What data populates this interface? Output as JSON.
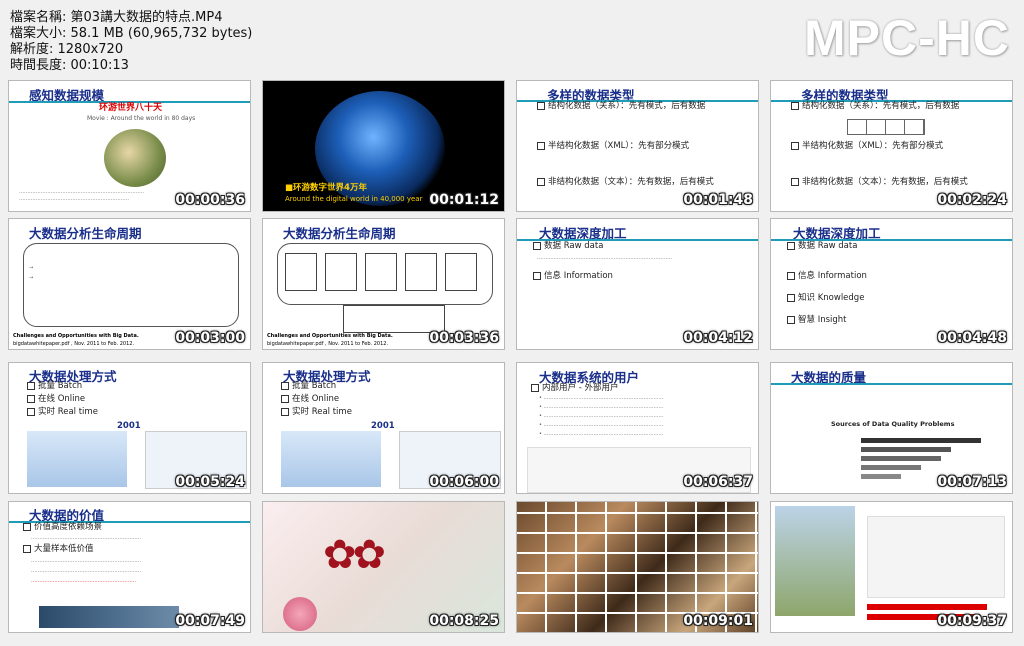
{
  "file_info": {
    "filename": "檔案名稱: 第03講大数据的特点.MP4",
    "filesize": "檔案大小: 58.1 MB (60,965,732 bytes)",
    "resolution": "解析度: 1280x720",
    "duration": "時間長度: 00:10:13"
  },
  "brand": "MPC-HC",
  "thumbs": [
    {
      "time": "00:00:36",
      "title": "感知数据规模",
      "sub": "环游世界八十天",
      "sub2": "Movie : Around the world in 80 days"
    },
    {
      "time": "00:01:12",
      "caption": "■环游数字世界4万年",
      "caption2": "Around the digital world in 40,000 year"
    },
    {
      "time": "00:01:48",
      "title": "多样的数据类型",
      "b1": "结构化数据（关系）：先有模式，后有数据",
      "b2": "半结构化数据（XML）：先有部分模式",
      "b3": "非结构化数据（文本）：先有数据，后有模式"
    },
    {
      "time": "00:02:24",
      "title": "多样的数据类型",
      "b1": "结构化数据（关系）：先有模式，后有数据",
      "b2": "半结构化数据（XML）：先有部分模式",
      "b3": "非结构化数据（文本）：先有数据，后有模式"
    },
    {
      "time": "00:03:00",
      "title": "大数据分析生命周期",
      "foot": "Challenges and Opportunities with Big Data.",
      "foot2": "bigdatawhitepaper.pdf , Nov. 2011 to Feb. 2012."
    },
    {
      "time": "00:03:36",
      "title": "大数据分析生命周期",
      "foot": "Challenges and Opportunities with Big Data.",
      "foot2": "bigdatawhitepaper.pdf , Nov. 2011 to Feb. 2012."
    },
    {
      "time": "00:04:12",
      "title": "大数据深度加工",
      "b1": "数据 Raw data",
      "b2": "信息 Information"
    },
    {
      "time": "00:04:48",
      "title": "大数据深度加工",
      "b1": "数据 Raw data",
      "b2": "信息 Information",
      "b3": "知识 Knowledge",
      "b4": "智慧 Insight"
    },
    {
      "time": "00:05:24",
      "title": "大数据处理方式",
      "b1": "批量 Batch",
      "b2": "在线 Online",
      "b3": "实时 Real time",
      "year": "2001"
    },
    {
      "time": "00:06:00",
      "title": "大数据处理方式",
      "b1": "批量 Batch",
      "b2": "在线 Online",
      "b3": "实时 Real time",
      "year": "2001"
    },
    {
      "time": "00:06:37",
      "title": "大数据系统的用户",
      "b1": "内部用户 - 外部用户"
    },
    {
      "time": "00:07:13",
      "title": "大数据的质量",
      "chart_title": "Sources of Data Quality Problems"
    },
    {
      "time": "00:07:49",
      "title": "大数据的价值",
      "b1": "价值高度依赖场景",
      "b2": "大量样本低价值"
    },
    {
      "time": "00:08:25"
    },
    {
      "time": "00:09:01"
    },
    {
      "time": "00:09:37"
    }
  ]
}
